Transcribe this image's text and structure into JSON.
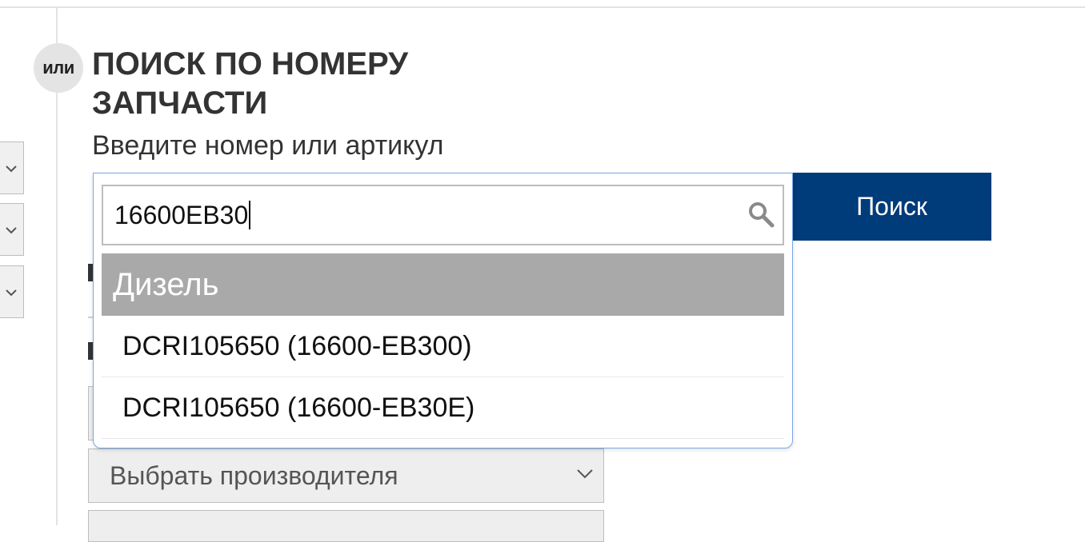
{
  "section": {
    "badge": "или",
    "title": "ПОИСК ПО НОМЕРУ ЗАПЧАСТИ",
    "subtitle": "Введите номер или артикул"
  },
  "search": {
    "value": "16600EB30",
    "button_label": "Поиск",
    "icon": "search-icon"
  },
  "autocomplete": {
    "group_label": "Дизель",
    "items": [
      {
        "label": "DCRI105650 (16600-EB300)"
      },
      {
        "label": "DCRI105650 (16600-EB30E)"
      }
    ]
  },
  "filters": {
    "manufacturer_placeholder": "Выбрать производителя"
  },
  "colors": {
    "primary_button": "#003b7a",
    "group_header": "#a9a9a9",
    "focus_border": "#7aa7e8"
  }
}
